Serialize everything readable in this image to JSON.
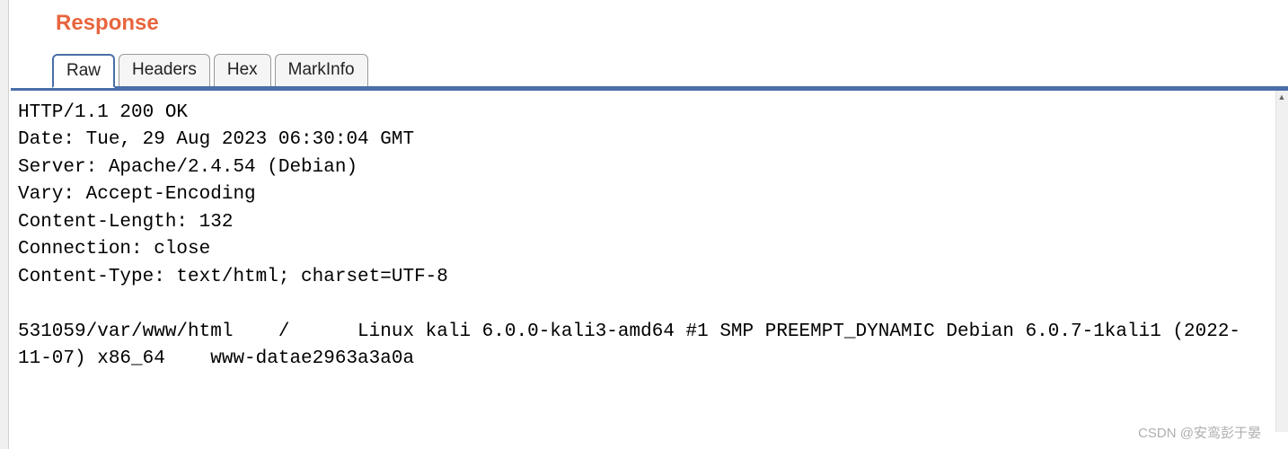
{
  "panel": {
    "title": "Response"
  },
  "tabs": {
    "raw": "Raw",
    "headers": "Headers",
    "hex": "Hex",
    "markinfo": "MarkInfo"
  },
  "response": {
    "raw": "HTTP/1.1 200 OK\nDate: Tue, 29 Aug 2023 06:30:04 GMT\nServer: Apache/2.4.54 (Debian)\nVary: Accept-Encoding\nContent-Length: 132\nConnection: close\nContent-Type: text/html; charset=UTF-8\n\n531059/var/www/html    /      Linux kali 6.0.0-kali3-amd64 #1 SMP PREEMPT_DYNAMIC Debian 6.0.7-1kali1 (2022-11-07) x86_64    www-datae2963a3a0a"
  },
  "watermark": "CSDN @安鸾彭于晏"
}
